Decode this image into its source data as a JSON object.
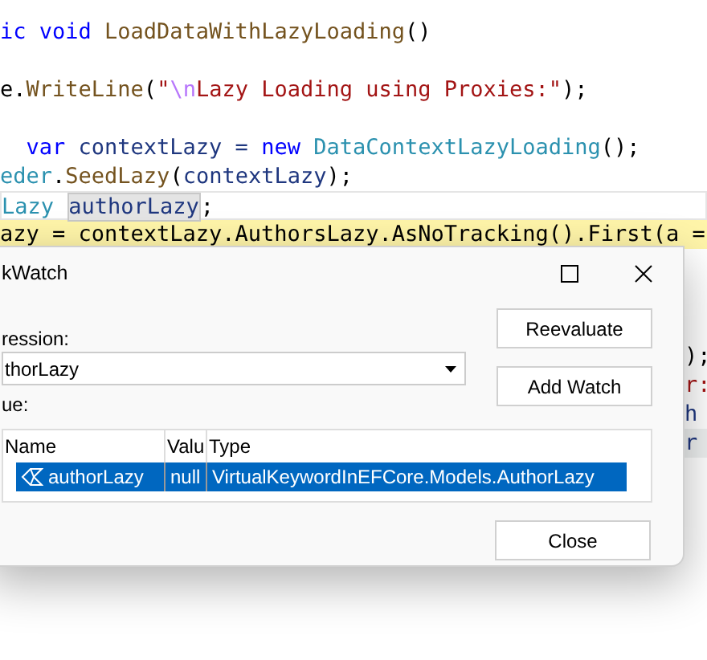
{
  "editor": {
    "lines": [
      {
        "current": false,
        "execution": false,
        "tokens": [
          {
            "text": "ic void",
            "kind": "keyword"
          },
          {
            "text": " LoadDataWithLazyLoading",
            "kind": "method"
          },
          {
            "text": "()",
            "kind": "plain"
          }
        ]
      },
      {
        "current": false,
        "execution": false,
        "tokens": [
          {
            "text": "e.",
            "kind": "plain"
          },
          {
            "text": "WriteLine",
            "kind": "method"
          },
          {
            "text": "(",
            "kind": "plain"
          },
          {
            "text": "\"",
            "kind": "string"
          },
          {
            "text": "\\n",
            "kind": "escape"
          },
          {
            "text": "Lazy Loading using Proxies:\"",
            "kind": "string"
          },
          {
            "text": ");",
            "kind": "plain"
          }
        ]
      },
      {
        "current": false,
        "execution": false,
        "tokens": [
          {
            "text": "  var",
            "kind": "keyword"
          },
          {
            "text": " contextLazy = ",
            "kind": "ident"
          },
          {
            "text": "new",
            "kind": "keyword"
          },
          {
            "text": " DataContextLazyLoading",
            "kind": "type"
          },
          {
            "text": "();",
            "kind": "plain"
          }
        ]
      },
      {
        "current": false,
        "execution": false,
        "tokens": [
          {
            "text": "eder",
            "kind": "type"
          },
          {
            "text": ".",
            "kind": "plain"
          },
          {
            "text": "SeedLazy",
            "kind": "method"
          },
          {
            "text": "(",
            "kind": "plain"
          },
          {
            "text": "contextLazy",
            "kind": "ident"
          },
          {
            "text": ");",
            "kind": "plain"
          }
        ]
      },
      {
        "current": true,
        "execution": false,
        "tokens": [
          {
            "text": "Lazy ",
            "kind": "type"
          },
          {
            "text": "authorLazy",
            "kind": "ident",
            "highlighted": true
          },
          {
            "text": ";",
            "kind": "plain"
          }
        ]
      },
      {
        "current": false,
        "execution": true,
        "tokens": [
          {
            "text": "azy = contextLazy.AuthorsLazy.AsNoTracking().First(a =",
            "kind": "plain"
          }
        ]
      }
    ],
    "fragments": [
      {
        "text": ");",
        "kind": "plain"
      },
      {
        "text": "r:",
        "kind": "string"
      },
      {
        "text": "h",
        "kind": "ident"
      },
      {
        "text": "r",
        "kind": "ident"
      }
    ]
  },
  "dialog": {
    "title": "kWatch",
    "expression_label": "ression:",
    "expression": "thorLazy",
    "value_label": "ue:",
    "table": {
      "columns": [
        "Name",
        "Valu",
        "Type"
      ],
      "rows": [
        {
          "name": "authorLazy",
          "value": "null",
          "type": "VirtualKeywordInEFCore.Models.AuthorLazy",
          "selected": true
        }
      ]
    },
    "buttons": [
      "Reevaluate",
      "Add Watch"
    ],
    "close_button": "Close"
  }
}
